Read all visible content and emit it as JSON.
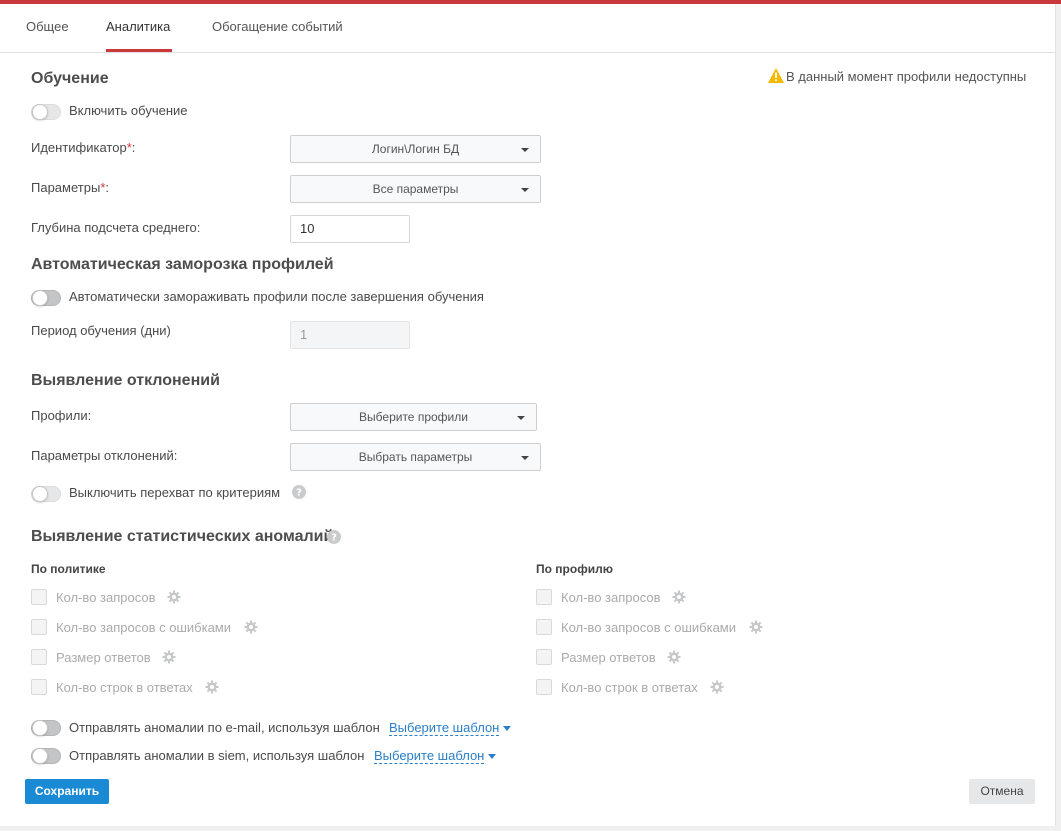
{
  "tabs": [
    {
      "label": "Общее"
    },
    {
      "label": "Аналитика"
    },
    {
      "label": "Обогащение событий"
    }
  ],
  "warning": {
    "text": "В данный момент профили недоступны"
  },
  "learning": {
    "title": "Обучение",
    "enable_label": "Включить обучение",
    "identifier_label": "Идентификатор",
    "identifier_value": "Логин\\Логин БД",
    "params_label": "Параметры",
    "params_value": "Все параметры",
    "depth_label": "Глубина подсчета среднего:",
    "depth_value": "10",
    "required_mark": "*",
    "colon": ":"
  },
  "freeze": {
    "title": "Автоматическая заморозка профилей",
    "toggle_label": "Автоматически замораживать профили после завершения обучения",
    "period_label": "Период обучения (дни)",
    "period_value": "1"
  },
  "deviations": {
    "title": "Выявление отклонений",
    "profiles_label": "Профили:",
    "profiles_placeholder": "Выберите профили",
    "params_label": "Параметры отклонений:",
    "params_placeholder": "Выбрать параметры",
    "disable_intercept_label": "Выключить перехват по критериям"
  },
  "anomalies": {
    "title": "Выявление статистических аномалий",
    "by_policy": {
      "title": "По политике",
      "items": [
        "Кол-во запросов",
        "Кол-во запросов с ошибками",
        "Размер ответов",
        "Кол-во строк в ответах"
      ]
    },
    "by_profile": {
      "title": "По профилю",
      "items": [
        "Кол-во запросов",
        "Кол-во запросов с ошибками",
        "Размер ответов",
        "Кол-во строк в ответах"
      ]
    },
    "email_label": "Отправлять аномалии по e-mail, используя шаблон",
    "siem_label": "Отправлять аномалии в siem, используя шаблон",
    "template_link": "Выберите шаблон"
  },
  "buttons": {
    "save": "Сохранить",
    "cancel": "Отмена"
  },
  "colors": {
    "accent": "#c9383a",
    "primary": "#1a8ad4",
    "link": "#2a7fc8",
    "warning": "#f5b800"
  }
}
